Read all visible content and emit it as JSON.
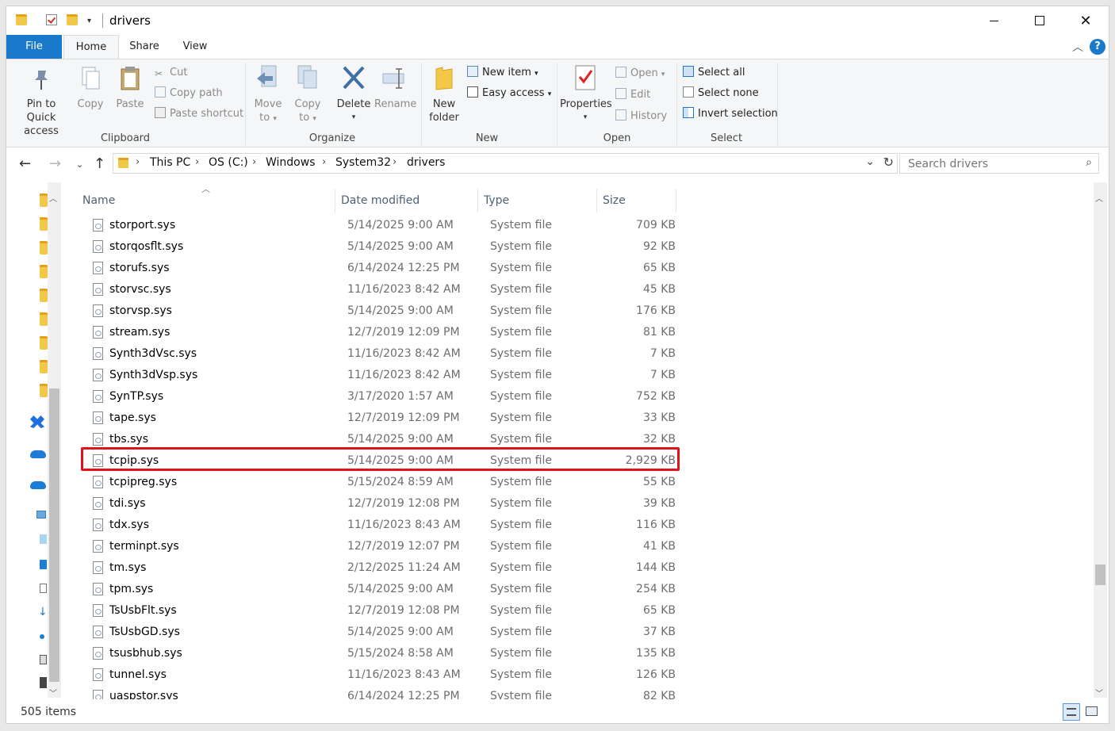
{
  "window": {
    "title": "drivers"
  },
  "ribbon_tabs": [
    "File",
    "Home",
    "Share",
    "View"
  ],
  "help_label": "?",
  "ribbon": {
    "clipboard": {
      "label": "Clipboard",
      "pin": "Pin to Quick access",
      "pin_line1": "Pin to Quick",
      "pin_line2": "access",
      "copy": "Copy",
      "paste": "Paste",
      "cut": "Cut",
      "copy_path": "Copy path",
      "paste_shortcut": "Paste shortcut"
    },
    "organize": {
      "label": "Organize",
      "move_to_line1": "Move",
      "move_to_line2": "to",
      "copy_to_line1": "Copy",
      "copy_to_line2": "to",
      "delete": "Delete",
      "rename": "Rename"
    },
    "new": {
      "label": "New",
      "new_folder_line1": "New",
      "new_folder_line2": "folder",
      "new_item": "New item",
      "easy_access": "Easy access"
    },
    "open": {
      "label": "Open",
      "properties": "Properties",
      "open": "Open",
      "edit": "Edit",
      "history": "History"
    },
    "select": {
      "label": "Select",
      "select_all": "Select all",
      "select_none": "Select none",
      "invert": "Invert selection"
    }
  },
  "breadcrumb": [
    "This PC",
    "OS (C:)",
    "Windows",
    "System32",
    "drivers"
  ],
  "search": {
    "placeholder": "Search drivers"
  },
  "columns": {
    "name": "Name",
    "date": "Date modified",
    "type": "Type",
    "size": "Size"
  },
  "files": [
    {
      "name": "storport.sys",
      "date": "5/14/2025 9:00 AM",
      "type": "System file",
      "size": "709 KB"
    },
    {
      "name": "storqosflt.sys",
      "date": "5/14/2025 9:00 AM",
      "type": "System file",
      "size": "92 KB"
    },
    {
      "name": "storufs.sys",
      "date": "6/14/2024 12:25 PM",
      "type": "System file",
      "size": "65 KB"
    },
    {
      "name": "storvsc.sys",
      "date": "11/16/2023 8:42 AM",
      "type": "System file",
      "size": "45 KB"
    },
    {
      "name": "storvsp.sys",
      "date": "5/14/2025 9:00 AM",
      "type": "System file",
      "size": "176 KB"
    },
    {
      "name": "stream.sys",
      "date": "12/7/2019 12:09 PM",
      "type": "System file",
      "size": "81 KB"
    },
    {
      "name": "Synth3dVsc.sys",
      "date": "11/16/2023 8:42 AM",
      "type": "System file",
      "size": "7 KB"
    },
    {
      "name": "Synth3dVsp.sys",
      "date": "11/16/2023 8:42 AM",
      "type": "System file",
      "size": "7 KB"
    },
    {
      "name": "SynTP.sys",
      "date": "3/17/2020 1:57 AM",
      "type": "System file",
      "size": "752 KB"
    },
    {
      "name": "tape.sys",
      "date": "12/7/2019 12:09 PM",
      "type": "System file",
      "size": "33 KB"
    },
    {
      "name": "tbs.sys",
      "date": "5/14/2025 9:00 AM",
      "type": "System file",
      "size": "32 KB"
    },
    {
      "name": "tcpip.sys",
      "date": "5/14/2025 9:00 AM",
      "type": "System file",
      "size": "2,929 KB"
    },
    {
      "name": "tcpipreg.sys",
      "date": "5/15/2024 8:59 AM",
      "type": "System file",
      "size": "55 KB"
    },
    {
      "name": "tdi.sys",
      "date": "12/7/2019 12:08 PM",
      "type": "System file",
      "size": "39 KB"
    },
    {
      "name": "tdx.sys",
      "date": "11/16/2023 8:43 AM",
      "type": "System file",
      "size": "116 KB"
    },
    {
      "name": "terminpt.sys",
      "date": "12/7/2019 12:07 PM",
      "type": "System file",
      "size": "41 KB"
    },
    {
      "name": "tm.sys",
      "date": "2/12/2025 11:24 AM",
      "type": "System file",
      "size": "144 KB"
    },
    {
      "name": "tpm.sys",
      "date": "5/14/2025 9:00 AM",
      "type": "System file",
      "size": "254 KB"
    },
    {
      "name": "TsUsbFlt.sys",
      "date": "12/7/2019 12:08 PM",
      "type": "System file",
      "size": "65 KB"
    },
    {
      "name": "TsUsbGD.sys",
      "date": "5/14/2025 9:00 AM",
      "type": "System file",
      "size": "37 KB"
    },
    {
      "name": "tsusbhub.sys",
      "date": "5/15/2024 8:58 AM",
      "type": "System file",
      "size": "135 KB"
    },
    {
      "name": "tunnel.sys",
      "date": "11/16/2023 8:43 AM",
      "type": "System file",
      "size": "126 KB"
    },
    {
      "name": "uaspstor.sys",
      "date": "6/14/2024 12:25 PM",
      "type": "System file",
      "size": "82 KB"
    }
  ],
  "highlighted_file": "tcpip.sys",
  "status": {
    "items": "505 items"
  },
  "colors": {
    "accent": "#1979ca",
    "highlight": "#e0131a",
    "folder": "#f2c849"
  }
}
